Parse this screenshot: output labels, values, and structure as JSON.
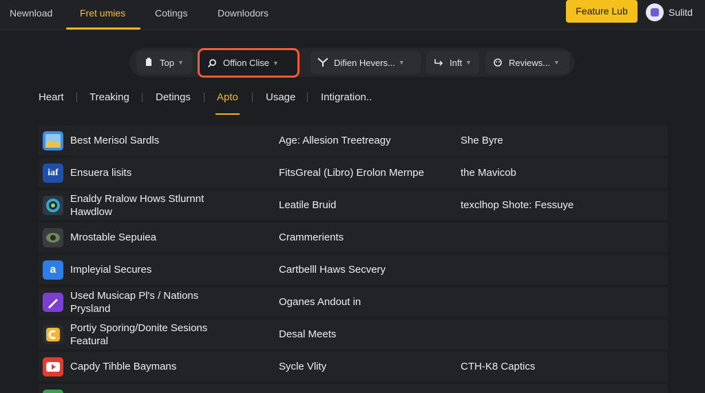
{
  "topnav": {
    "items": [
      "Newnload",
      "Fret umies",
      "Cotings",
      "Downlodors"
    ],
    "active_index": 1,
    "cta_label": "Feature Lub",
    "user_name": "Sulitd",
    "accent_color": "#f5c01c"
  },
  "filters": {
    "pills": [
      {
        "icon": "tag-icon",
        "label": "Top"
      },
      {
        "icon": "search-icon",
        "label": "Offion Clise"
      },
      {
        "icon": "filter-icon",
        "label": "Difien Hevers..."
      },
      {
        "icon": "return-icon",
        "label": "Inft"
      },
      {
        "icon": "reviews-icon",
        "label": "Reviews..."
      }
    ],
    "focused_index": 1,
    "focus_color": "#ff5a36"
  },
  "tabs": {
    "items": [
      "Heart",
      "Treaking",
      "Detings",
      "Apto",
      "Usage",
      "Intigration.."
    ],
    "active_index": 3
  },
  "rows": [
    {
      "icon": "image-app-icon",
      "name": "Best Merisol Sardls",
      "detail": "Age: Allesion Treetreagy",
      "extra": "She Byre"
    },
    {
      "icon": "iaf-app-icon",
      "name": "Ensuera lisits",
      "detail": "FitsGreal (Libro) Erolon Mernpe",
      "extra": "the Mavicob"
    },
    {
      "icon": "circle-app-icon",
      "name": "Enaldy Rralow Hows Stlurnnt Hawdlow",
      "detail": "Leatile Bruid",
      "extra": "texclhop Shote: Fessuye"
    },
    {
      "icon": "eye-app-icon",
      "name": "Mrostable Sepuiea",
      "detail": "Crammerients",
      "extra": ""
    },
    {
      "icon": "a-app-icon",
      "name": "Impleyial Secures",
      "detail": "Cartbelll Haws Secvery",
      "extra": ""
    },
    {
      "icon": "pen-app-icon",
      "name": "Used Musicap Pl's / Nations Prysland",
      "detail": "Oganes Andout in",
      "extra": ""
    },
    {
      "icon": "c-app-icon",
      "name": "Portiy Sporing/Donite Sesions Featural",
      "detail": "Desal Meets",
      "extra": ""
    },
    {
      "icon": "play-app-icon",
      "name": "Capdy Tihble Baymans",
      "detail": "Sycle Vlity",
      "extra": "CTH-K8 Captics"
    }
  ]
}
